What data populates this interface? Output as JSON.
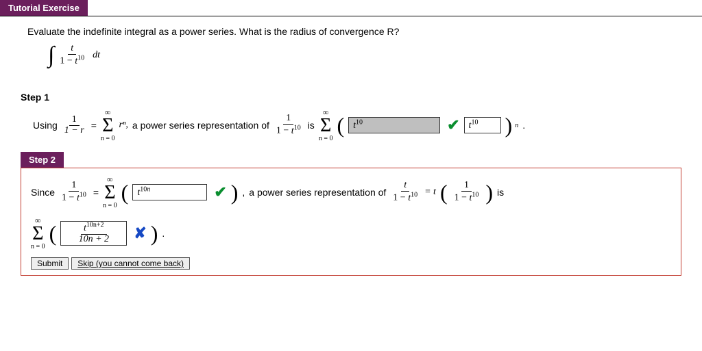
{
  "header": {
    "tutorial_label": "Tutorial Exercise"
  },
  "prompt": {
    "text": "Evaluate the indefinite integral as a power series. What is the radius of convergence R?",
    "int_num": "t",
    "int_den_pre": "1 − ",
    "int_den_var": "t",
    "int_den_exp": "10",
    "int_dt": "dt"
  },
  "step1": {
    "label": "Step 1",
    "using": "Using",
    "lhs_num": "1",
    "lhs_den": "1 − r",
    "eq": "=",
    "rn": "rⁿ,",
    "mid": "a power series representation of",
    "frac2_num": "1",
    "frac2_den_pre": "1 − ",
    "frac2_den_var": "t",
    "frac2_den_exp": "10",
    "is": "is",
    "ans1": "t10",
    "ans2": "t10",
    "tail_exp": "n",
    "period": ".",
    "sigma_top": "∞",
    "sigma_bot": "n = 0"
  },
  "step2": {
    "label": "Step 2",
    "since": "Since",
    "frac_num": "1",
    "frac_den_pre": "1 − ",
    "frac_den_var": "t",
    "frac_den_exp": "10",
    "eq": "=",
    "ans1": "t10n",
    "mid": "a power series representation of",
    "frac2_num": "t",
    "frac2_den_pre": "1 − ",
    "frac2_den_var": "t",
    "frac2_den_exp": "10",
    "eq2": "= t",
    "paren_inner_num": "1",
    "paren_inner_den_pre": "1 − ",
    "paren_inner_den_var": "t",
    "paren_inner_den_exp": "10",
    "is": "is",
    "ans2_num_var": "t",
    "ans2_num_exp": "10n+2",
    "ans2_den": "10n + 2",
    "period": ".",
    "sigma_top": "∞",
    "sigma_bot": "n = 0",
    "submit": "Submit",
    "skip": "Skip (you cannot come back)"
  },
  "marks": {
    "check": "✔",
    "cross": "✘"
  }
}
